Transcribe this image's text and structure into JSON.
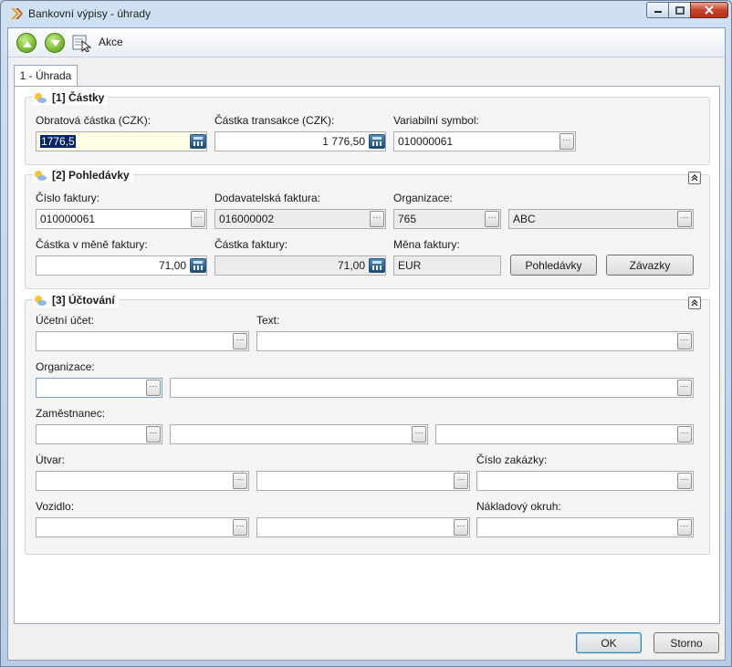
{
  "window": {
    "title": "Bankovní výpisy - úhrady"
  },
  "toolbar": {
    "akce_label": "Akce"
  },
  "tab": {
    "label": "1 - Úhrada"
  },
  "castky": {
    "title": "[1] Částky",
    "obratova_label": "Obratová částka (CZK):",
    "obratova_value": "1776,5",
    "transakce_label": "Částka transakce (CZK):",
    "transakce_value": "1 776,50",
    "vs_label": "Variabilní symbol:",
    "vs_value": "010000061"
  },
  "pohledavky": {
    "title": "[2] Pohledávky",
    "cislo_faktury_label": "Číslo faktury:",
    "cislo_faktury_value": "010000061",
    "dodavatelska_label": "Dodavatelská faktura:",
    "dodavatelska_value": "016000002",
    "organizace_label": "Organizace:",
    "organizace_code": "765",
    "organizace_name": "ABC",
    "castka_mena_label": "Částka v měně faktury:",
    "castka_mena_value": "71,00",
    "castka_faktury_label": "Částka faktury:",
    "castka_faktury_value": "71,00",
    "mena_label": "Měna faktury:",
    "mena_value": "EUR",
    "btn_pohledavky": "Pohledávky",
    "btn_zavazky": "Závazky"
  },
  "uctovani": {
    "title": "[3] Účtování",
    "ucet_label": "Účetní účet:",
    "text_label": "Text:",
    "organizace_label": "Organizace:",
    "zamestnanec_label": "Zaměstnanec:",
    "utvar_label": "Útvar:",
    "zakazka_label": "Číslo zakázky:",
    "vozidlo_label": "Vozidlo:",
    "okruh_label": "Nákladový okruh:"
  },
  "footer": {
    "ok": "OK",
    "storno": "Storno"
  },
  "ellipsis": "···"
}
